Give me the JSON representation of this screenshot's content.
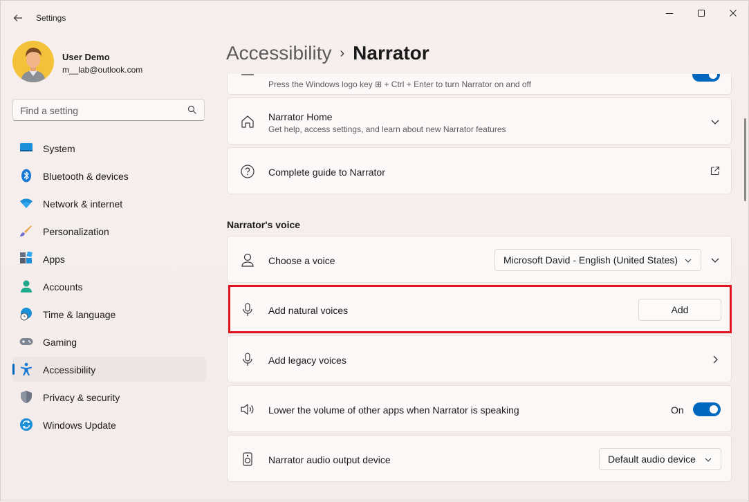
{
  "window": {
    "title": "Settings"
  },
  "user": {
    "name": "User Demo",
    "email": "m__lab@outlook.com"
  },
  "search": {
    "placeholder": "Find a setting"
  },
  "sidebar": {
    "items": [
      {
        "label": "System",
        "icon": "monitor-icon"
      },
      {
        "label": "Bluetooth & devices",
        "icon": "bluetooth-icon"
      },
      {
        "label": "Network & internet",
        "icon": "wifi-icon"
      },
      {
        "label": "Personalization",
        "icon": "brush-icon"
      },
      {
        "label": "Apps",
        "icon": "apps-icon"
      },
      {
        "label": "Accounts",
        "icon": "person-icon"
      },
      {
        "label": "Time & language",
        "icon": "globe-clock-icon"
      },
      {
        "label": "Gaming",
        "icon": "gamepad-icon"
      },
      {
        "label": "Accessibility",
        "icon": "accessibility-icon"
      },
      {
        "label": "Privacy & security",
        "icon": "shield-icon"
      },
      {
        "label": "Windows Update",
        "icon": "update-icon"
      }
    ],
    "active": "Accessibility"
  },
  "breadcrumb": {
    "parent": "Accessibility",
    "separator": "›",
    "current": "Narrator"
  },
  "main": {
    "shortcut_sub": "Press the Windows logo key ⊞ + Ctrl + Enter to turn Narrator on and off",
    "narrator_home": {
      "title": "Narrator Home",
      "sub": "Get help, access settings, and learn about new Narrator features"
    },
    "guide": {
      "title": "Complete guide to Narrator"
    },
    "voice_section": "Narrator's voice",
    "choose_voice": {
      "title": "Choose a voice",
      "value": "Microsoft David - English (United States)"
    },
    "natural_voices": {
      "title": "Add natural voices",
      "button": "Add"
    },
    "legacy_voices": {
      "title": "Add legacy voices"
    },
    "lower_volume": {
      "title": "Lower the volume of other apps when Narrator is speaking",
      "state": "On"
    },
    "audio_output": {
      "title": "Narrator audio output device",
      "value": "Default audio device"
    }
  },
  "colors": {
    "accent": "#0067c0",
    "highlight": "#e0141e"
  }
}
